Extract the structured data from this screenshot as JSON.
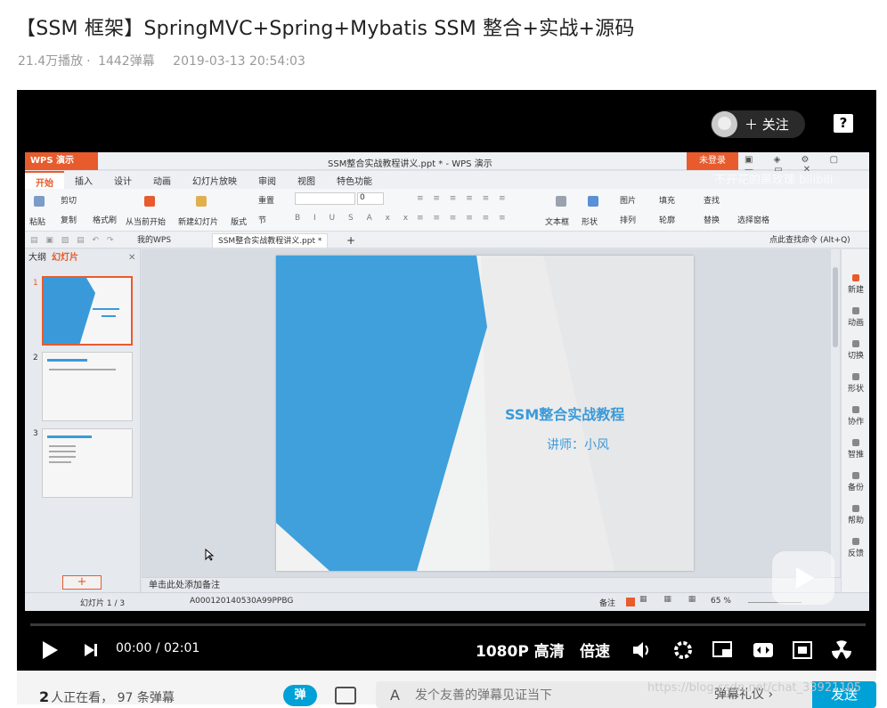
{
  "video": {
    "title": "【SSM 框架】SpringMVC+Spring+Mybatis SSM 整合+实战+源码",
    "plays": "21.4万播放",
    "danmaku_count": "1442弹幕",
    "date": "2019-03-13 20:54:03"
  },
  "player": {
    "follow_label": "＋ 关注",
    "help_label": "?",
    "watermark": "不开花的黑玫瑰 bilibili",
    "time_current": "00:00",
    "time_sep": "/",
    "time_total": "02:01",
    "quality": "1080P 高清",
    "speed": "倍速"
  },
  "wps": {
    "app_label": "WPS 演示",
    "doc_title": "SSM整合实战教程讲义.ppt * - WPS 演示",
    "login": "未登录",
    "menus": [
      "开始",
      "插入",
      "设计",
      "动画",
      "幻灯片放映",
      "审阅",
      "视图",
      "特色功能"
    ],
    "ribbon": {
      "paste": "粘贴",
      "cut": "剪切",
      "copy": "复制",
      "format_painter": "格式刷",
      "from_current": "从当前开始",
      "new_slide": "新建幻灯片",
      "layout": "版式",
      "reset": "重置",
      "section": "节",
      "font_size": "0",
      "textbox": "文本框",
      "shape": "形状",
      "picture": "图片",
      "fill": "填充",
      "arrange": "排列",
      "outline": "轮廓",
      "find": "查找",
      "replace": "替换",
      "select_pane": "选择窗格"
    },
    "tabs": [
      "我的WPS",
      "SSM整合实战教程讲义.ppt *"
    ],
    "find_cmd": "点此查找命令 (Alt+Q)",
    "panel_outline": "大纲",
    "panel_slides": "幻灯片",
    "slide_nums": [
      "1",
      "2",
      "3"
    ],
    "slide": {
      "title": "SSM整合实战教程",
      "subtitle": "讲师：小风"
    },
    "notes": "单击此处添加备注",
    "sidebar": [
      "新建",
      "动画",
      "切换",
      "形状",
      "协作",
      "智推",
      "备份",
      "帮助",
      "反馈"
    ],
    "status": {
      "slide_pos": "幻灯片 1 / 3",
      "template": "A000120140530A99PPBG",
      "notes_btn": "备注",
      "zoom": "65 %"
    }
  },
  "bottom": {
    "watching_count": "2",
    "watching_label": "人正在看，",
    "danmaku_total": "97 条弹幕",
    "dm_toggle": "弹",
    "input_placeholder": "发个友善的弹幕见证当下",
    "etiquette": "弹幕礼仪 ›",
    "send": "发送"
  },
  "overlay": {
    "csdn": "https://blog.csdn.net/chat_33921105"
  }
}
